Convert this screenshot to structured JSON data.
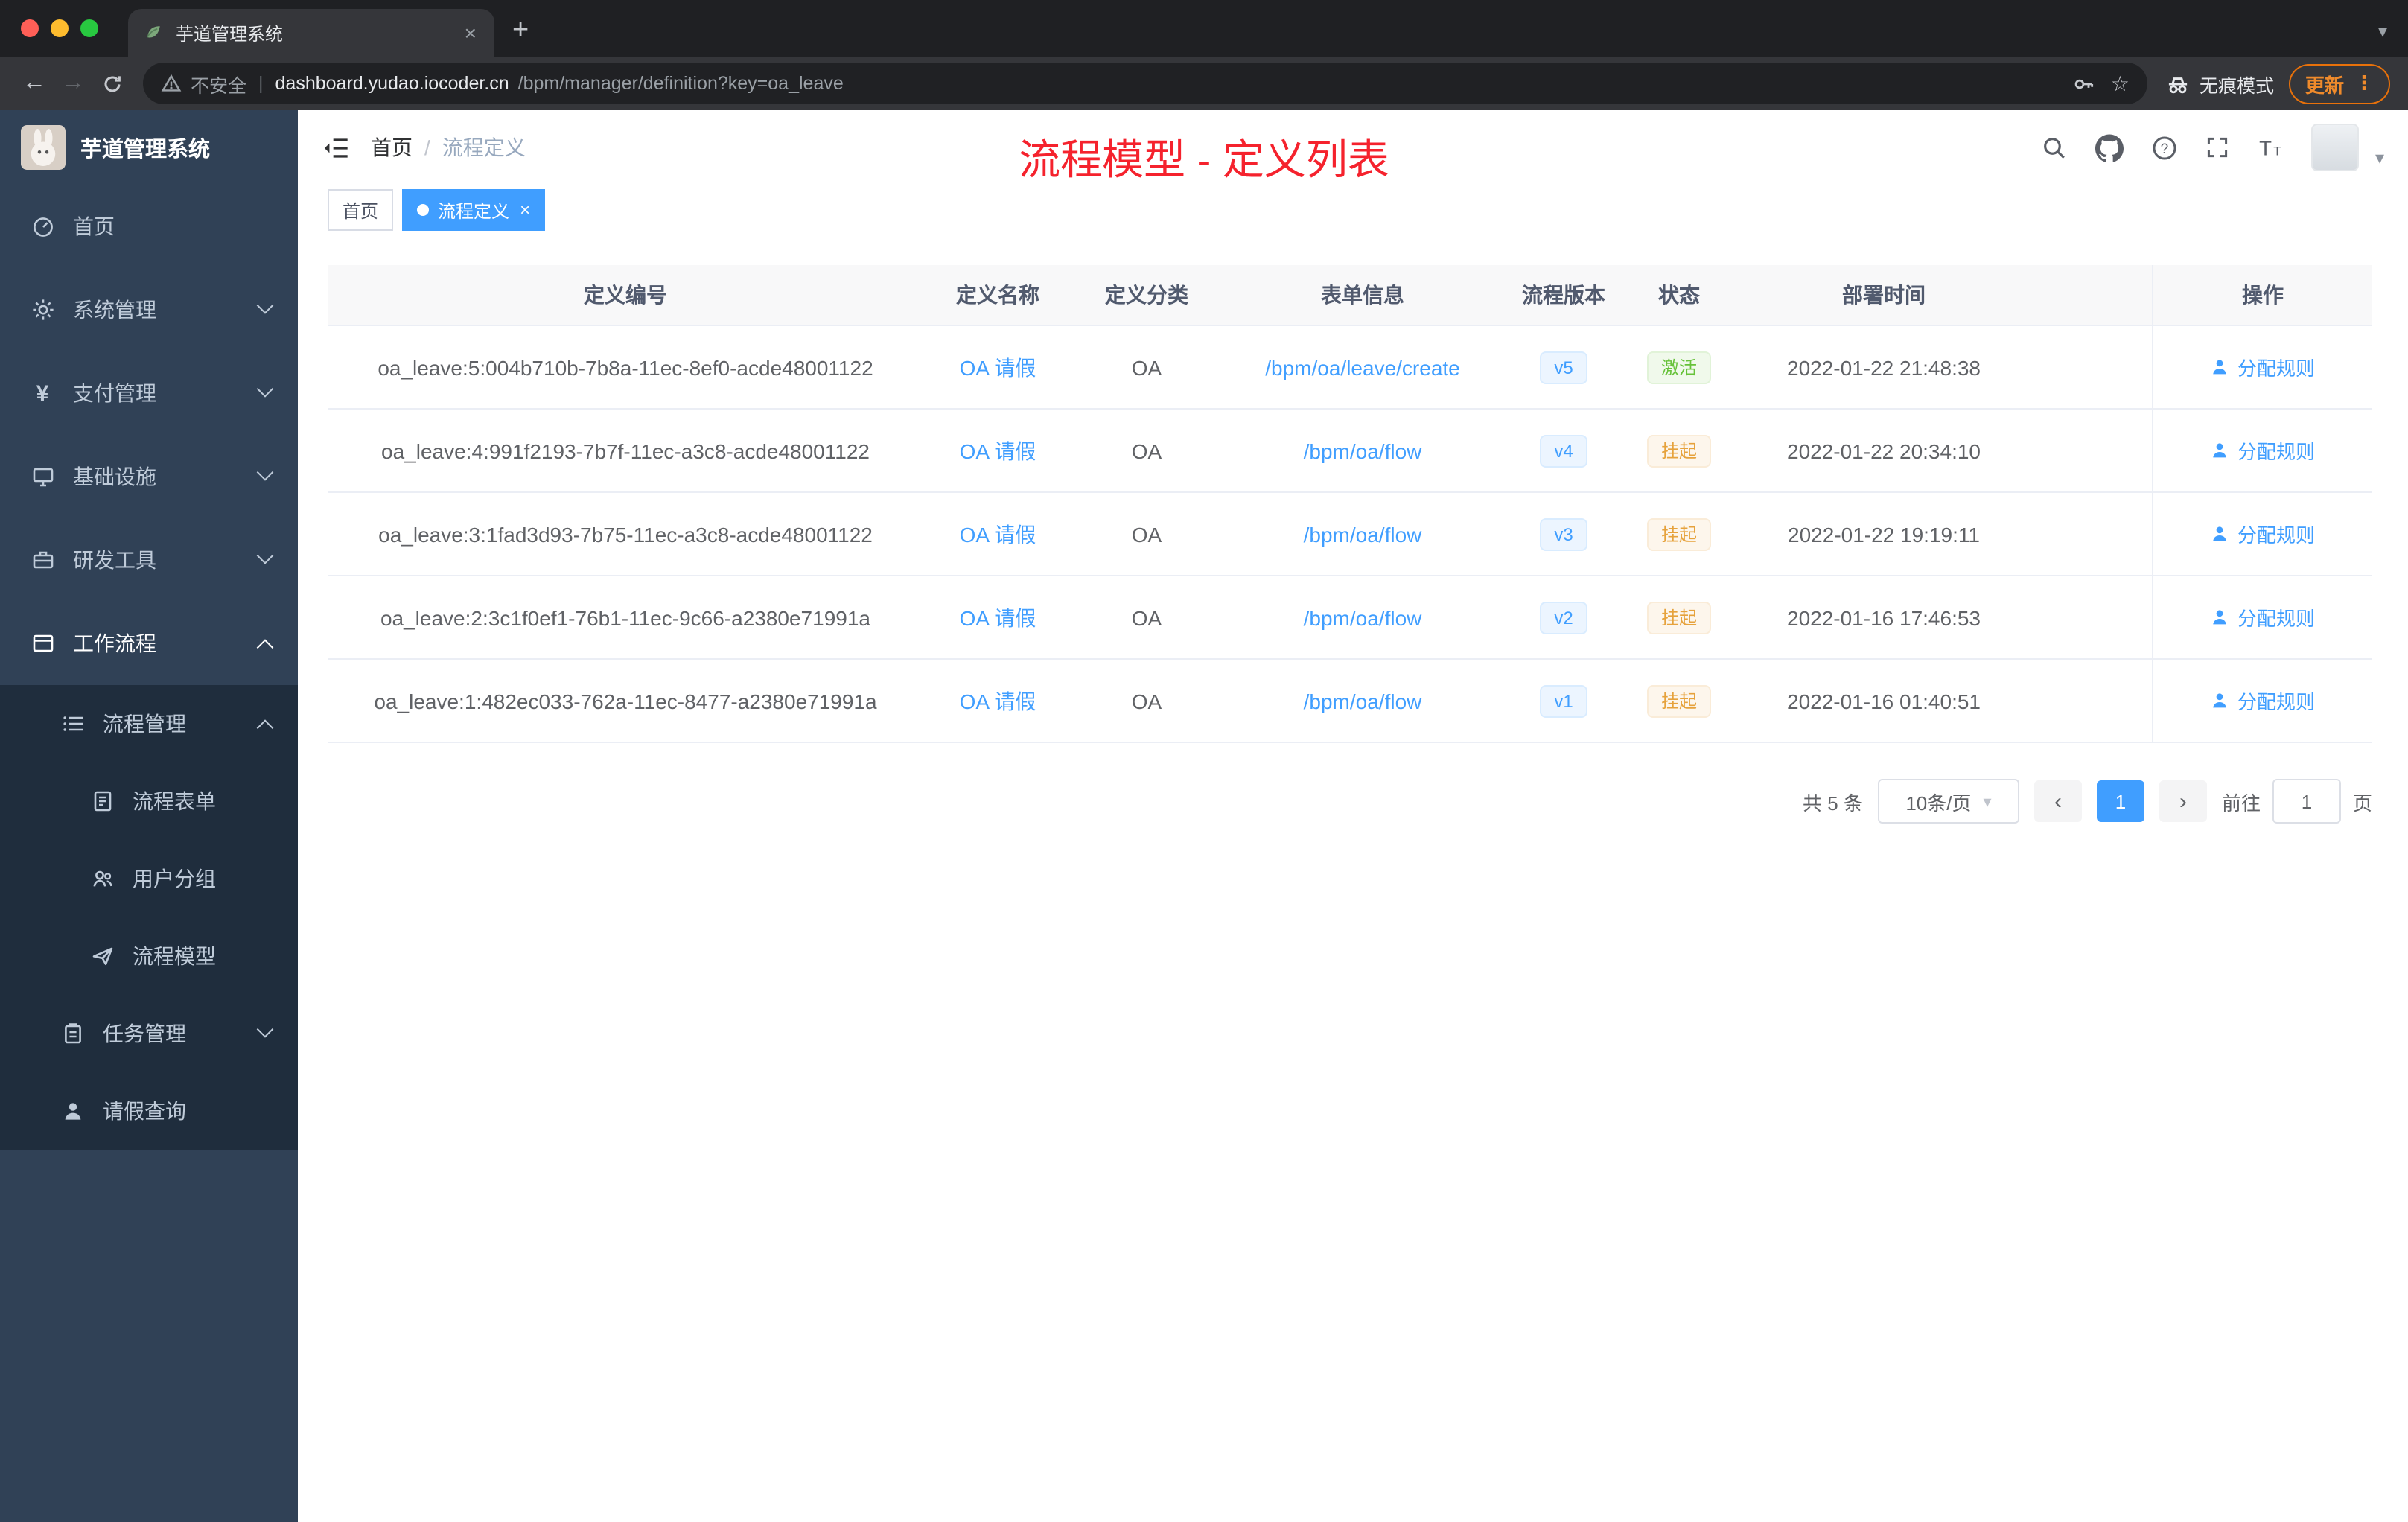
{
  "browser": {
    "tab_title": "芋道管理系统",
    "security_label": "不安全",
    "url_host": "dashboard.yudao.iocoder.cn",
    "url_path": "/bpm/manager/definition?key=oa_leave",
    "incognito_label": "无痕模式",
    "update_label": "更新",
    "glyphs": {
      "back": "←",
      "forward": "→",
      "new_tab": "+",
      "close": "×",
      "star": "☆",
      "menu_dots": "⋮",
      "tab_caret": "▾"
    }
  },
  "sidebar": {
    "app_title": "芋道管理系统",
    "yen_glyph": "¥",
    "items": [
      {
        "label": "首页"
      },
      {
        "label": "系统管理"
      },
      {
        "label": "支付管理"
      },
      {
        "label": "基础设施"
      },
      {
        "label": "研发工具"
      },
      {
        "label": "工作流程"
      },
      {
        "label": "流程管理"
      },
      {
        "label": "流程表单"
      },
      {
        "label": "用户分组"
      },
      {
        "label": "流程模型"
      },
      {
        "label": "任务管理"
      },
      {
        "label": "请假查询"
      }
    ]
  },
  "header": {
    "breadcrumb_home": "首页",
    "breadcrumb_sep": "/",
    "breadcrumb_current": "流程定义",
    "overlay_title": "流程模型 - 定义列表"
  },
  "tags": {
    "home": "首页",
    "active": "流程定义",
    "close_glyph": "×"
  },
  "table": {
    "columns": [
      "定义编号",
      "定义名称",
      "定义分类",
      "表单信息",
      "流程版本",
      "状态",
      "部署时间",
      "操作"
    ],
    "action_label": "分配规则",
    "rows": [
      {
        "id": "oa_leave:5:004b710b-7b8a-11ec-8ef0-acde48001122",
        "name": "OA 请假",
        "category": "OA",
        "form": "/bpm/oa/leave/create",
        "version": "v5",
        "status": "激活",
        "time": "2022-01-22 21:48:38"
      },
      {
        "id": "oa_leave:4:991f2193-7b7f-11ec-a3c8-acde48001122",
        "name": "OA 请假",
        "category": "OA",
        "form": "/bpm/oa/flow",
        "version": "v4",
        "status": "挂起",
        "time": "2022-01-22 20:34:10"
      },
      {
        "id": "oa_leave:3:1fad3d93-7b75-11ec-a3c8-acde48001122",
        "name": "OA 请假",
        "category": "OA",
        "form": "/bpm/oa/flow",
        "version": "v3",
        "status": "挂起",
        "time": "2022-01-22 19:19:11"
      },
      {
        "id": "oa_leave:2:3c1f0ef1-76b1-11ec-9c66-a2380e71991a",
        "name": "OA 请假",
        "category": "OA",
        "form": "/bpm/oa/flow",
        "version": "v2",
        "status": "挂起",
        "time": "2022-01-16 17:46:53"
      },
      {
        "id": "oa_leave:1:482ec033-762a-11ec-8477-a2380e71991a",
        "name": "OA 请假",
        "category": "OA",
        "form": "/bpm/oa/flow",
        "version": "v1",
        "status": "挂起",
        "time": "2022-01-16 01:40:51"
      }
    ]
  },
  "pagination": {
    "total": "共 5 条",
    "page_size": "10条/页",
    "caret_glyph": "▾",
    "prev_glyph": "‹",
    "next_glyph": "›",
    "page": "1",
    "goto_prefix": "前往",
    "goto_value": "1",
    "goto_suffix": "页"
  },
  "colors": {
    "accent": "#409eff",
    "status_active": "#67c23a",
    "status_suspended": "#e6a23c",
    "title_red": "#f5222d",
    "sidebar_bg": "#304156",
    "submenu_bg": "#1f2d3d"
  }
}
